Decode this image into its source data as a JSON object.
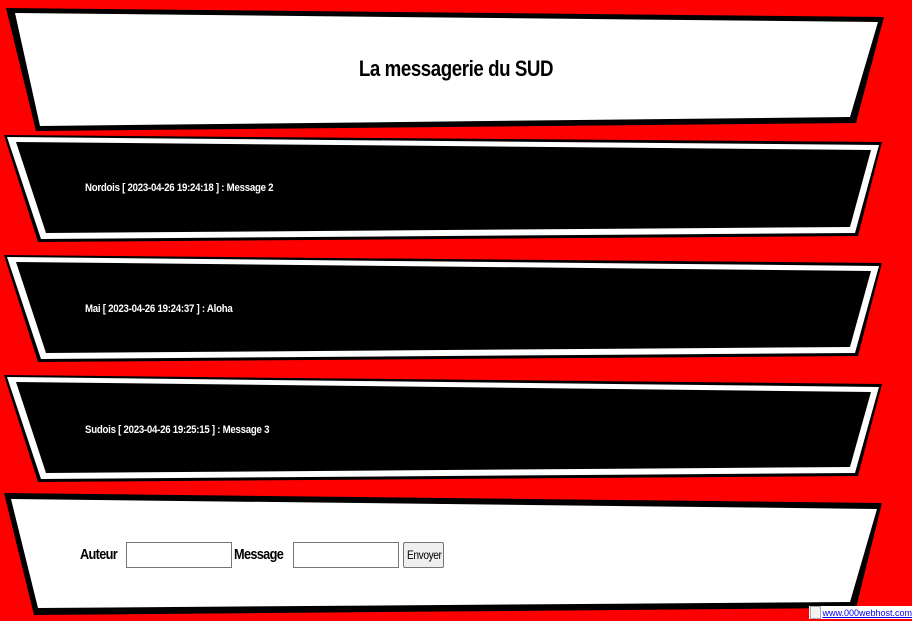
{
  "header": {
    "title": "La messagerie du SUD"
  },
  "messages": [
    {
      "text": "Nordois [ 2023-04-26 19:24:18 ] : Message 2"
    },
    {
      "text": "Mai [ 2023-04-26 19:24:37 ] : Aloha"
    },
    {
      "text": "Sudois [ 2023-04-26 19:25:15 ] : Message 3"
    }
  ],
  "form": {
    "author_label": "Auteur",
    "author_value": "",
    "message_label": "Message",
    "message_value": "",
    "send_label": "Envoyer"
  },
  "footer": {
    "link_text": "www.000webhost.com"
  },
  "colors": {
    "background": "#ff0000",
    "header_panel": "#ffffff",
    "message_panel": "#000000",
    "form_panel": "#ffffff"
  }
}
